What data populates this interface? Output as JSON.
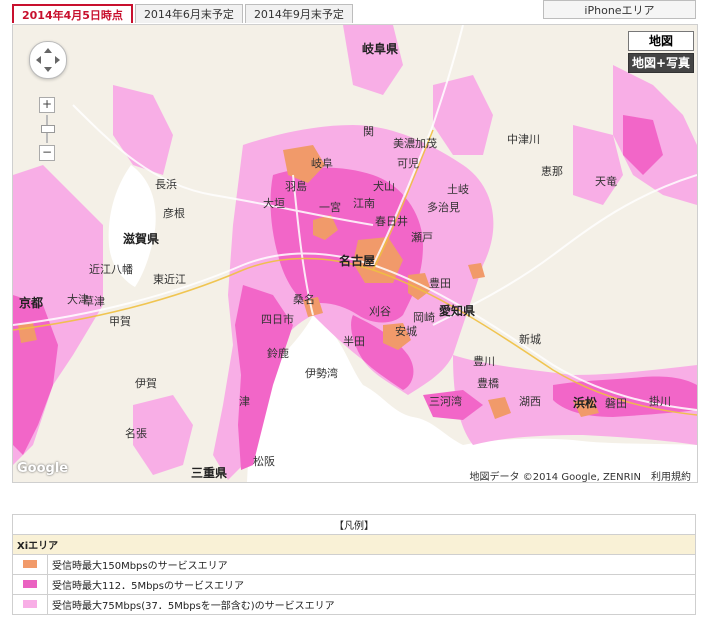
{
  "tabs": [
    {
      "label": "2014年4月5日時点",
      "active": true
    },
    {
      "label": "2014年6月末予定",
      "active": false
    },
    {
      "label": "2014年9月末予定",
      "active": false
    }
  ],
  "iphone_button": "iPhoneエリア",
  "map": {
    "type_map_label": "地図",
    "type_photo_label": "地図+写真",
    "zoom_in": "+",
    "zoom_out": "−",
    "google_logo": "Google",
    "copyright": "地図データ ©2014 Google, ZENRIN　利用規約",
    "colors": {
      "land": "#f4f0e7",
      "water": "#ffffff",
      "light_pink": "#f8aee6",
      "pink": "#f266c8",
      "orange": "#f19a6a"
    },
    "labels": {
      "gifu_pref": "岐阜県",
      "gifu": "岐阜",
      "ogaki": "大垣",
      "hashima": "羽島",
      "ichinomiya": "一宮",
      "konan": "江南",
      "kasugai": "春日井",
      "inuyama": "犬山",
      "kani": "可児",
      "minokamo": "美濃加茂",
      "seki": "関",
      "tajimi": "多治見",
      "toki": "土岐",
      "nagoya": "名古屋",
      "seto": "瀬戸",
      "toyota": "豊田",
      "okazaki": "岡崎",
      "anjo": "安城",
      "kariya": "刈谷",
      "handa": "半田",
      "toyokawa": "豊川",
      "toyohashi": "豊橋",
      "hamamatsu": "浜松",
      "iwata": "磐田",
      "kakegawa": "掛川",
      "kosai": "湖西",
      "shinshiro": "新城",
      "aichi_pref": "愛知県",
      "mie_pref": "三重県",
      "yokkaichi": "四日市",
      "kuwana": "桑名",
      "suzuka": "鈴鹿",
      "tsu": "津",
      "matsusaka": "松阪",
      "iga": "伊賀",
      "nabari": "名張",
      "shiga_pref": "滋賀県",
      "hikone": "彦根",
      "nagahama": "長浜",
      "omi_hachiman": "近江八幡",
      "kusatsu": "草津",
      "otsu": "大津",
      "kyoto": "京都",
      "koka": "甲賀",
      "ise_bay": "伊勢湾",
      "mikawa_bay": "三河湾",
      "nakatsugawa": "中津川",
      "ena": "恵那",
      "tenryu": "天竜",
      "higashiomi": "東近江"
    }
  },
  "legend": {
    "title": "【凡例】",
    "section": "Xiエリア",
    "rows": [
      {
        "color": "#f19a6a",
        "label": "受信時最大150Mbpsのサービスエリア"
      },
      {
        "color": "#ea62c1",
        "label": "受信時最大112．5Mbpsのサービスエリア"
      },
      {
        "color": "#f8aee6",
        "label": "受信時最大75Mbps(37．5Mbpsを一部含む)のサービスエリア"
      }
    ]
  }
}
